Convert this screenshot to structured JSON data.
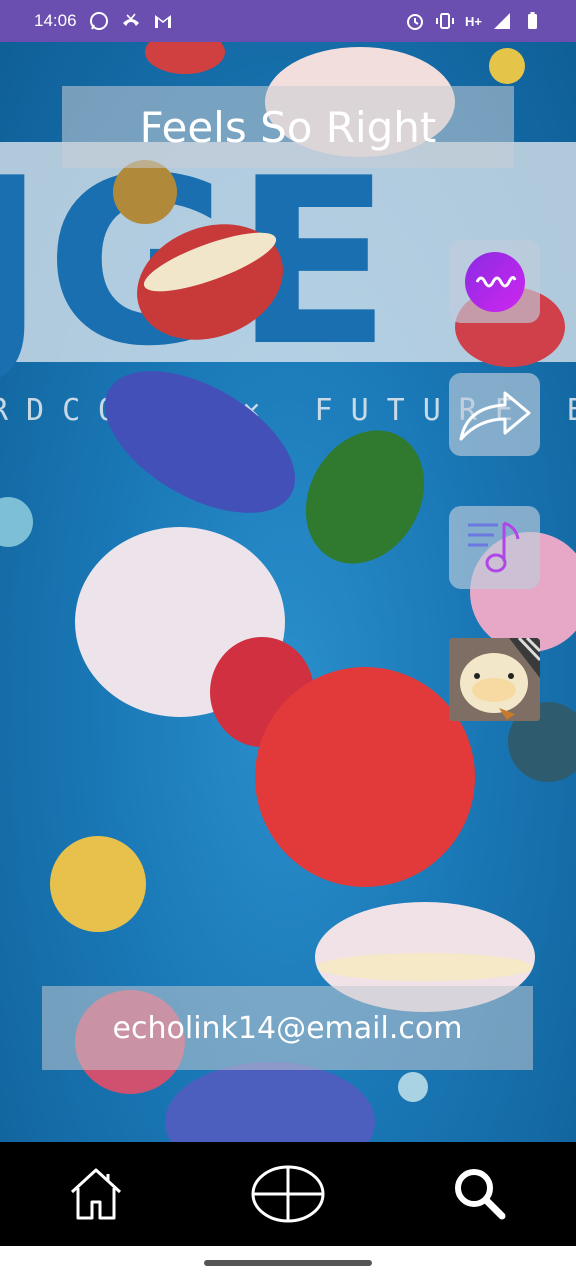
{
  "status_bar": {
    "time": "14:06",
    "network": "H+",
    "left_icons": [
      "whatsapp-icon",
      "missed-call-icon",
      "gmail-icon"
    ],
    "right_icons": [
      "alarm-icon",
      "vibrate-icon",
      "network-type-icon",
      "signal-icon",
      "battery-icon"
    ],
    "color": "#6a4fb0"
  },
  "song": {
    "title": "Feels So Right"
  },
  "cover_art": {
    "logo_text": "JGE",
    "subtitle_text": "RDCORE × FUTURE BASS"
  },
  "side_actions": [
    {
      "name": "wave-icon",
      "label": ""
    },
    {
      "name": "share-icon",
      "label": ""
    },
    {
      "name": "playlist-icon",
      "label": ""
    },
    {
      "name": "profile-thumbnail",
      "label": ""
    }
  ],
  "user": {
    "email": "echolink14@email.com"
  },
  "bottom_nav": {
    "items": [
      "home-icon",
      "add-icon",
      "search-icon"
    ]
  },
  "colors": {
    "accent": "#a040f0",
    "wave_gradient_start": "#8a2be2",
    "wave_gradient_end": "#d026f0",
    "background_blue": "#1a78b6"
  }
}
